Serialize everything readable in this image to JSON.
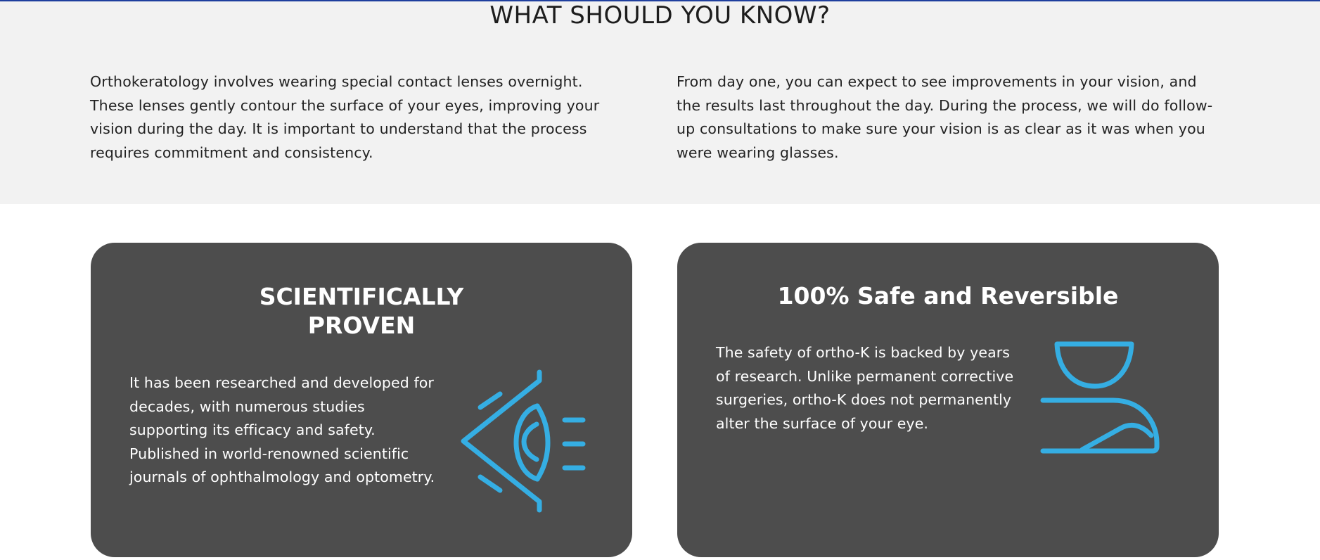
{
  "header": {
    "title": "WHAT SHOULD YOU KNOW?"
  },
  "intro": {
    "left_paragraph": "Orthokeratology involves wearing special contact lenses overnight. These lenses gently contour the surface of your eyes, improving your vision during the day. It is important to understand that the process requires commitment and consistency.",
    "right_paragraph": "From day one, you can expect to see improvements in your vision, and the results last throughout the day. During the process, we will do follow-up consultations to make sure your vision is as clear as it was when you were wearing glasses."
  },
  "cards": [
    {
      "title_line1": "SCIENTIFICALLY",
      "title_line2": "PROVEN",
      "body": "It has been researched and developed for decades, with numerous studies supporting its efficacy and safety. Published in world-renowned scientific journals of ophthalmology and optometry.",
      "icon": "eye-icon"
    },
    {
      "title": "100% Safe and Reversible",
      "body": "The safety of ortho-K is backed by years of research. Unlike permanent corrective surgeries, ortho-K does not permanently alter the surface of your eye.",
      "icon": "eye-lens-icon"
    }
  ],
  "colors": {
    "band_background": "#f2f2f2",
    "card_background": "#4d4d4d",
    "icon_accent": "#35aee3",
    "top_rule": "#1f3f9e"
  }
}
